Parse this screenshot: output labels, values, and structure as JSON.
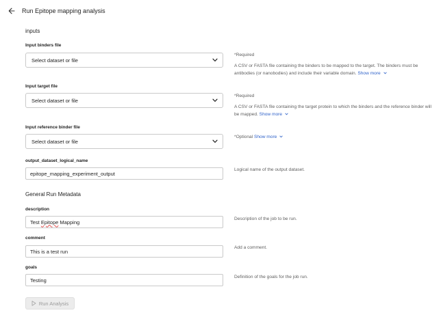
{
  "header": {
    "title": "Run Epitope mapping analysis"
  },
  "sections": {
    "inputs": "inputs",
    "general": "General Run Metadata"
  },
  "fields": {
    "binders": {
      "label": "Input binders file",
      "value": "Select dataset or file",
      "required": "*Required",
      "help": "A CSV or FASTA file containing the binders to be mapped to the target. The binders must be antibodies (or nanobodies) and include their variable domain.",
      "more": "Show more"
    },
    "target": {
      "label": "Input target file",
      "value": "Select dataset or file",
      "required": "*Required",
      "help": "A CSV or FASTA file containing the target protein to which the binders and the reference binder will be mapped.",
      "more": "Show more"
    },
    "reference": {
      "label": "Input reference binder file",
      "value": "Select dataset or file",
      "optional": "*Optional",
      "more": "Show more"
    },
    "output": {
      "label": "output_dataset_logical_name",
      "value": "epitope_mapping_experiment_output",
      "help": "Logical name of the output dataset."
    },
    "description": {
      "label": "description",
      "value_word1": "Test",
      "value_word2": "Epitope",
      "value_word3": "Mapping",
      "help": "Description of the job to be run."
    },
    "comment": {
      "label": "comment",
      "value": "This is a test run",
      "help": "Add a comment."
    },
    "goals": {
      "label": "goals",
      "value": "Testing",
      "help": "Definition of the goals for the job run."
    }
  },
  "actions": {
    "run": "Run Analysis"
  },
  "colors": {
    "link": "#2f62c9",
    "border": "#c9c9c9",
    "muted": "#5e5e5e",
    "disabled_bg": "#ececec"
  },
  "icons": {
    "back": "arrow-left-icon",
    "dropdown": "chevron-down-icon",
    "run": "play-icon"
  }
}
